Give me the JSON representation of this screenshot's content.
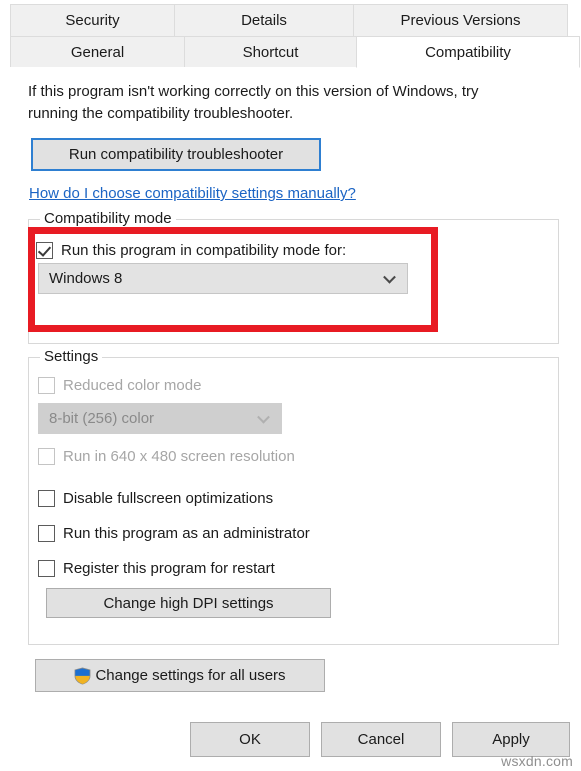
{
  "dialog": {
    "tabs_row1": [
      {
        "label": "Security",
        "selected": false
      },
      {
        "label": "Details",
        "selected": false
      },
      {
        "label": "Previous Versions",
        "selected": false
      }
    ],
    "tabs_row2": [
      {
        "label": "General",
        "selected": false
      },
      {
        "label": "Shortcut",
        "selected": false
      },
      {
        "label": "Compatibility",
        "selected": true
      }
    ]
  },
  "compatibility_page": {
    "intro_text": "If this program isn't working correctly on this version of Windows, try running the compatibility troubleshooter.",
    "troubleshoot_button": "Run compatibility troubleshooter",
    "help_link": "How do I choose compatibility settings manually?",
    "compatibility_mode": {
      "legend": "Compatibility mode",
      "checkbox_label": "Run this program in compatibility mode for:",
      "checkbox_checked": true,
      "dropdown_value": "Windows 8",
      "dropdown_enabled": true,
      "highlight_color": "#e81b23"
    },
    "settings": {
      "legend": "Settings",
      "items": [
        {
          "label": "Reduced color mode",
          "checked": false,
          "enabled": false
        },
        {
          "label": "Run in 640 x 480 screen resolution",
          "checked": false,
          "enabled": false
        },
        {
          "label": "Disable fullscreen optimizations",
          "checked": false,
          "enabled": true
        },
        {
          "label": "Run this program as an administrator",
          "checked": false,
          "enabled": true
        },
        {
          "label": "Register this program for restart",
          "checked": false,
          "enabled": true
        }
      ],
      "color_depth_value": "8-bit (256) color",
      "color_depth_enabled": false,
      "dpi_button": "Change high DPI settings"
    },
    "all_users_button": "Change settings for all users",
    "shield_icon": "uac-shield-icon"
  },
  "footer": {
    "ok": "OK",
    "cancel": "Cancel",
    "apply": "Apply"
  },
  "watermark": "wsxdn.com"
}
